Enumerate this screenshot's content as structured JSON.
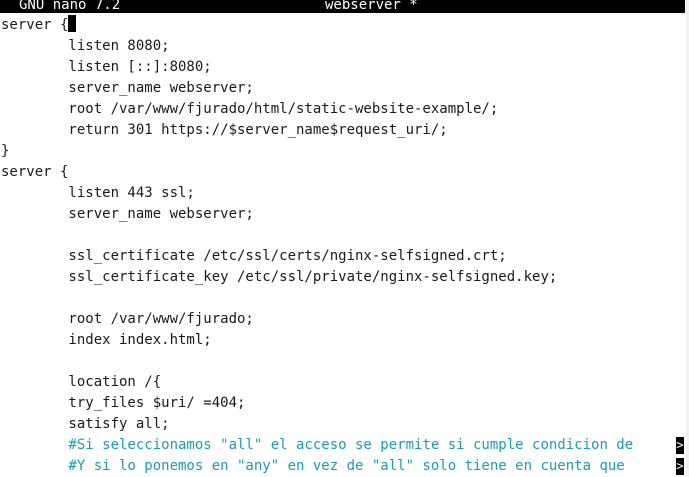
{
  "titlebar": {
    "version": "GNU nano 7.2",
    "filename": "webserver *"
  },
  "lines": [
    {
      "text": "server {",
      "cursor": true
    },
    {
      "text": "        listen 8080;"
    },
    {
      "text": "        listen [::]:8080;"
    },
    {
      "text": "        server_name webserver;"
    },
    {
      "text": "        root /var/www/fjurado/html/static-website-example/;"
    },
    {
      "text": "        return 301 https://$server_name$request_uri/;"
    },
    {
      "text": "}"
    },
    {
      "text": "server {"
    },
    {
      "text": "        listen 443 ssl;"
    },
    {
      "text": "        server_name webserver;"
    },
    {
      "text": ""
    },
    {
      "text": "        ssl_certificate /etc/ssl/certs/nginx-selfsigned.crt;"
    },
    {
      "text": "        ssl_certificate_key /etc/ssl/private/nginx-selfsigned.key;"
    },
    {
      "text": ""
    },
    {
      "text": "        root /var/www/fjurado;"
    },
    {
      "text": "        index index.html;"
    },
    {
      "text": ""
    },
    {
      "text": "        location /{"
    },
    {
      "text": "        try_files $uri/ =404;"
    },
    {
      "text": "        satisfy all;"
    },
    {
      "text": "        #Si seleccionamos \"all\" el acceso se permite si cumple condicion de",
      "comment": true,
      "overflow": ">"
    },
    {
      "text": "        #Y si lo ponemos en \"any\" en vez de \"all\" solo tiene en cuenta que ",
      "comment": true,
      "overflow": ">"
    }
  ],
  "colors": {
    "comment": "#1a9bb8",
    "text": "#1a1a1a",
    "titlebar_bg": "#000000",
    "titlebar_fg": "#ffffff"
  }
}
